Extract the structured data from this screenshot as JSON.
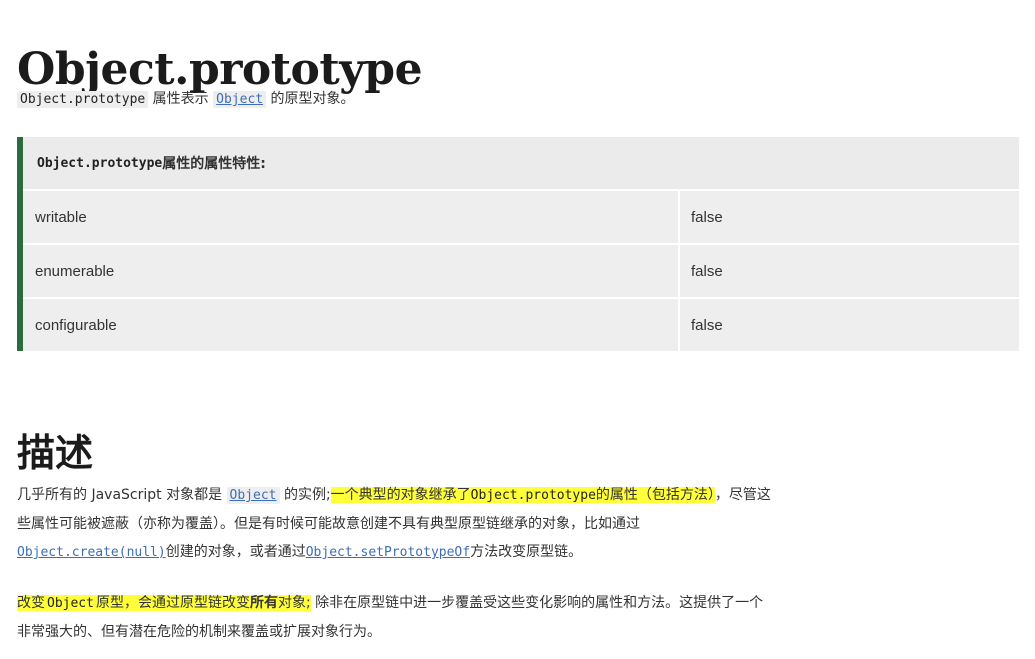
{
  "page": {
    "title": "Object.prototype",
    "intro": {
      "code1": "Object.prototype",
      "text1": " 属性表示 ",
      "link": "Object",
      "text2": " 的原型对象。"
    },
    "table": {
      "header_code": "Object.prototype",
      "header_text": " 属性的属性特性:",
      "rows": [
        {
          "name": "writable",
          "value": "false"
        },
        {
          "name": "enumerable",
          "value": "false"
        },
        {
          "name": "configurable",
          "value": "false"
        }
      ]
    },
    "section_title": "描述",
    "para1": {
      "t1": "几乎所有的 JavaScript 对象都是 ",
      "link1": "Object",
      "t2": " 的实例;",
      "hl1": "一个典型的对象继承了",
      "hl_code": "Object.prototype",
      "hl2": "的属性（包括方法）",
      "t3": "，尽管这些属性可能被遮蔽（亦称为覆盖）。但是有时候可能故意创建不具有典型原型链继承的对象，比如通过",
      "link2": "Object.create(null)",
      "t4": "创建的对象，或者通过",
      "link3": "Object.setPrototypeOf",
      "t5": "方法改变原型链。"
    },
    "para2": {
      "hl1": "改变",
      "hl_code": "Object",
      "hl2": "原型，会通过原型链改变",
      "hl_bold": "所有",
      "hl3": "对象;",
      "t1": " 除非在原型链中进一步覆盖受这些变化影响的属性和方法。这提供了一个非常强大的、但有潜在危险的机制来覆盖或扩展对象行为。"
    }
  },
  "colors": {
    "table_border": "#2d6a3e",
    "table_bg": "#eeeeee",
    "highlight": "#ffff3a",
    "link": "#3d6fb6"
  }
}
